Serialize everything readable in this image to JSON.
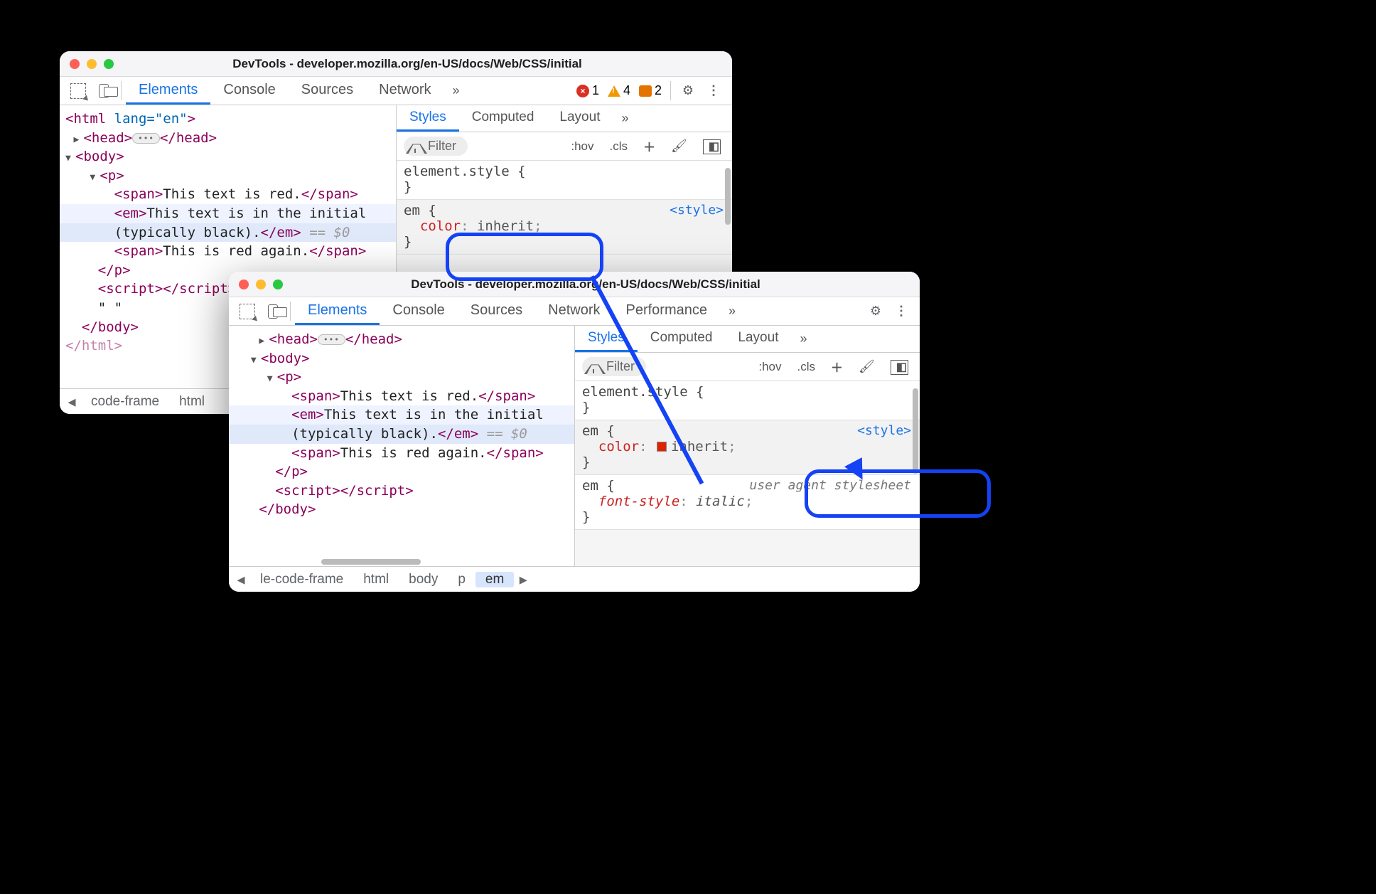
{
  "window1": {
    "title": "DevTools - developer.mozilla.org/en-US/docs/Web/CSS/initial",
    "tabs": [
      "Elements",
      "Console",
      "Sources",
      "Network"
    ],
    "activeTab": 0,
    "errors": "1",
    "warnings": "4",
    "issues": "2",
    "dom": {
      "l0_open": "<html ",
      "l0_attr": "lang=\"en\"",
      "l0_close": ">",
      "l1": "<head>",
      "l1b": "</head>",
      "l2": "<body>",
      "l3": "<p>",
      "l4a": "<span>",
      "l4t": "This text is red.",
      "l4b": "</span>",
      "l5a": "<em>",
      "l5t": "This text is in the initial ",
      "l5t2": "(typically black).",
      "l5b": "</em>",
      "l5g": " == $0",
      "l6a": "<span>",
      "l6t": "This is red again.",
      "l6b": "</span>",
      "l7": "</p>",
      "l8a": "<script>",
      "l8b": "</script>",
      "l9": "\" \"",
      "l10": "</body>",
      "l11": "</html>"
    },
    "stylesTabs": [
      "Styles",
      "Computed",
      "Layout"
    ],
    "filterPlaceholder": "Filter",
    "hov": ":hov",
    "cls": ".cls",
    "rule0": "element.style {",
    "rule0b": "}",
    "rule1sel": "em {",
    "rule1prop": "color",
    "rule1val": "inherit",
    "rule1semi": ";",
    "rule1b": "}",
    "styleTag": "<style>",
    "crumbs": [
      "code-frame",
      "html"
    ]
  },
  "window2": {
    "title": "DevTools - developer.mozilla.org/en-US/docs/Web/CSS/initial",
    "tabs": [
      "Elements",
      "Console",
      "Sources",
      "Network",
      "Performance"
    ],
    "activeTab": 0,
    "dom": {
      "l1": "<head>",
      "l1b": "</head>",
      "l2": "<body>",
      "l3": "<p>",
      "l4a": "<span>",
      "l4t": "This text is red.",
      "l4b": "</span>",
      "l5a": "<em>",
      "l5t": "This text is in the initial ",
      "l5t2": "(typically black).",
      "l5b": "</em>",
      "l5g": " == $0",
      "l6a": "<span>",
      "l6t": "This is red again.",
      "l6b": "</span>",
      "l7": "</p>",
      "l8a": "<script>",
      "l8b": "</script>",
      "l10": "</body>"
    },
    "stylesTabs": [
      "Styles",
      "Computed",
      "Layout"
    ],
    "filterPlaceholder": "Filter",
    "hov": ":hov",
    "cls": ".cls",
    "rule0": "element.style {",
    "rule0b": "}",
    "rule1sel": "em {",
    "rule1prop": "color",
    "rule1val": "inherit",
    "rule1semi": ";",
    "rule1b": "}",
    "rule2sel": "em {",
    "rule2prop": "font-style",
    "rule2val": "italic",
    "rule2semi": ";",
    "rule2b": "}",
    "styleTag": "<style>",
    "uaLabel": "user agent stylesheet",
    "crumbs": [
      "le-code-frame",
      "html",
      "body",
      "p",
      "em"
    ],
    "crumbActive": 4
  }
}
